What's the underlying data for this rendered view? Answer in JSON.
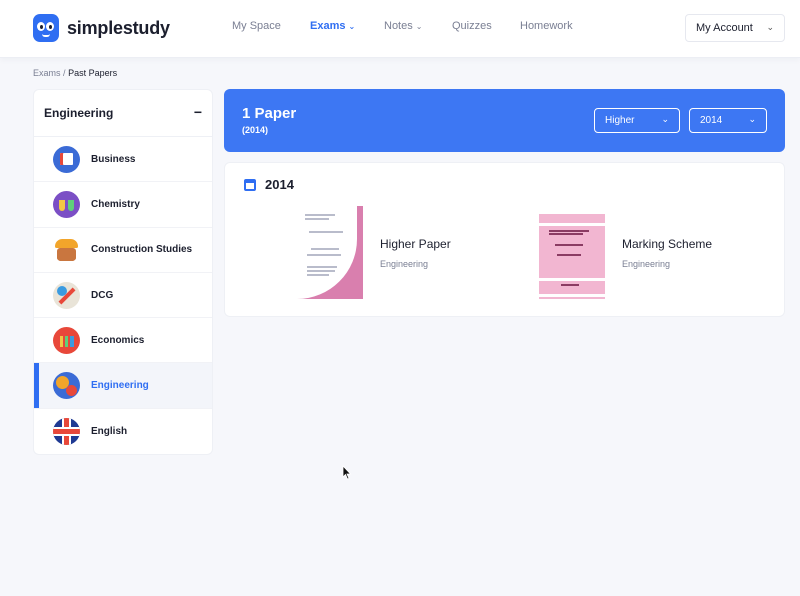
{
  "header": {
    "logo_text": "simplestudy",
    "nav": [
      {
        "label": "My Space",
        "has_menu": false,
        "active": false
      },
      {
        "label": "Exams",
        "has_menu": true,
        "active": true
      },
      {
        "label": "Notes",
        "has_menu": true,
        "active": false
      },
      {
        "label": "Quizzes",
        "has_menu": false,
        "active": false
      },
      {
        "label": "Homework",
        "has_menu": false,
        "active": false
      }
    ],
    "account_label": "My Account"
  },
  "breadcrumb": {
    "parent": "Exams",
    "separator": "/",
    "current": "Past Papers"
  },
  "sidebar": {
    "heading": "Engineering",
    "collapse_symbol": "−",
    "items": [
      {
        "label": "Business",
        "icon": "business-icon"
      },
      {
        "label": "Chemistry",
        "icon": "chemistry-icon"
      },
      {
        "label": "Construction Studies",
        "icon": "construction-icon"
      },
      {
        "label": "DCG",
        "icon": "dcg-icon"
      },
      {
        "label": "Economics",
        "icon": "economics-icon"
      },
      {
        "label": "Engineering",
        "icon": "engineering-icon",
        "active": true
      },
      {
        "label": "English",
        "icon": "english-flag-icon"
      }
    ]
  },
  "banner": {
    "title": "1 Paper",
    "subtitle": "(2014)",
    "level_select": "Higher",
    "year_select": "2014",
    "color": "#3d77f3"
  },
  "papers_section": {
    "year": "2014",
    "papers": [
      {
        "title": "Higher Paper",
        "subject": "Engineering"
      },
      {
        "title": "Marking Scheme",
        "subject": "Engineering"
      }
    ]
  },
  "colors": {
    "accent": "#2f6ef2",
    "background": "#f6f7fb"
  }
}
